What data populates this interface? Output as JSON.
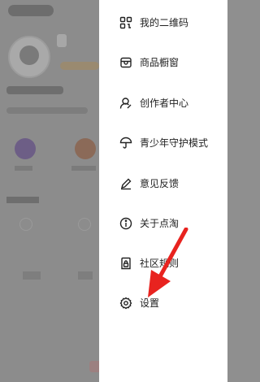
{
  "drawer": {
    "items": [
      {
        "label": "我的二维码",
        "icon": "qr-code-icon"
      },
      {
        "label": "商品橱窗",
        "icon": "shop-window-icon"
      },
      {
        "label": "创作者中心",
        "icon": "creator-icon"
      },
      {
        "label": "青少年守护模式",
        "icon": "umbrella-icon"
      },
      {
        "label": "意见反馈",
        "icon": "pencil-icon"
      },
      {
        "label": "关于点淘",
        "icon": "info-icon"
      },
      {
        "label": "社区规则",
        "icon": "lock-document-icon"
      },
      {
        "label": "设置",
        "icon": "gear-icon"
      }
    ]
  },
  "annotation": {
    "color": "#e8231f",
    "target": "设置"
  }
}
